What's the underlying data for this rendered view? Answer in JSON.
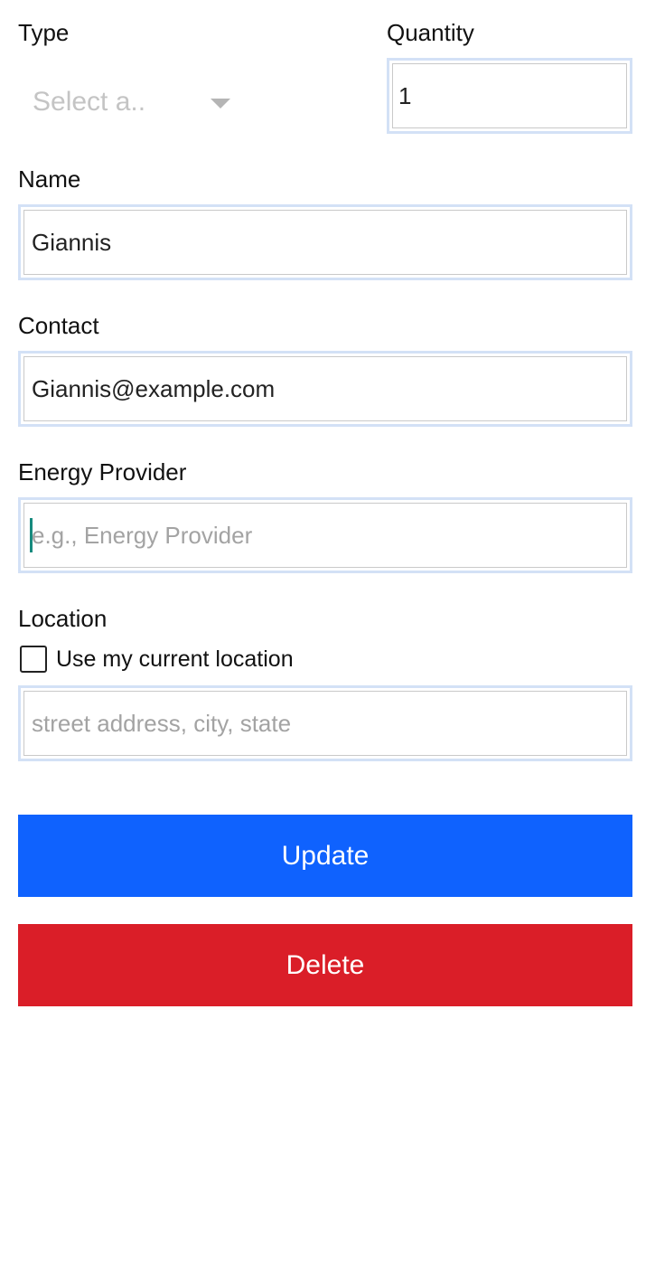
{
  "type": {
    "label": "Type",
    "placeholder": "Select a.."
  },
  "quantity": {
    "label": "Quantity",
    "value": "1"
  },
  "name": {
    "label": "Name",
    "value": "Giannis"
  },
  "contact": {
    "label": "Contact",
    "value": "Giannis@example.com"
  },
  "energy_provider": {
    "label": "Energy Provider",
    "placeholder": "e.g., Energy Provider"
  },
  "location": {
    "label": "Location",
    "use_current_label": "Use my current location",
    "use_current_checked": false,
    "placeholder": "street address, city, state"
  },
  "actions": {
    "update_label": "Update",
    "delete_label": "Delete"
  },
  "colors": {
    "update_button": "#0f62fe",
    "delete_button": "#da1e28",
    "field_focus_ring": "#d3e1f6",
    "caret": "#178a7e"
  }
}
